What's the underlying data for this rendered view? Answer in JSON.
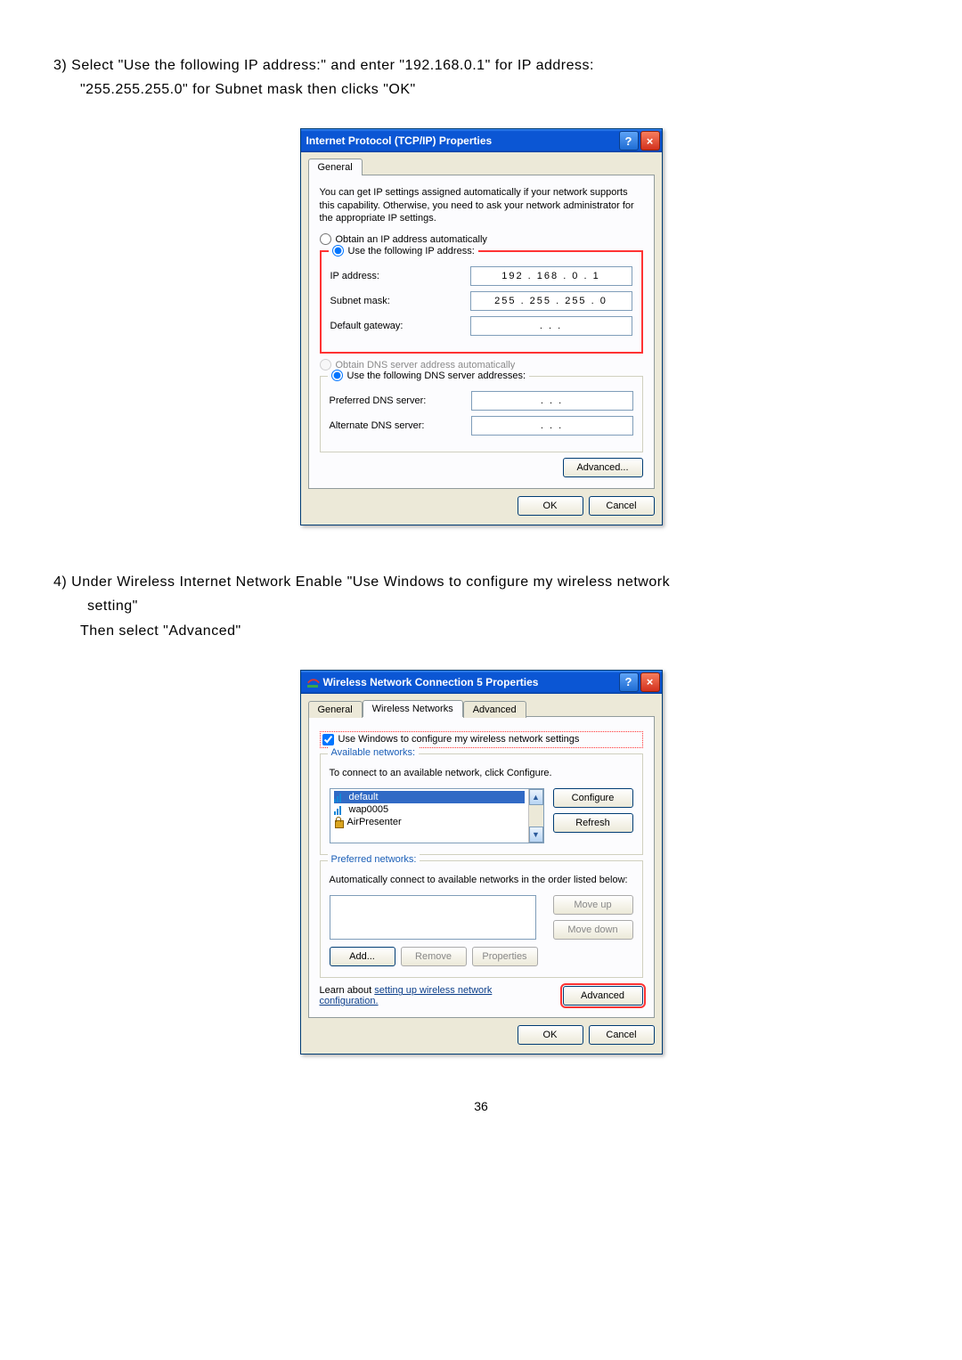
{
  "page_number": "36",
  "step3": {
    "prefix": "3)  Select \"Use the following IP address:\" and enter \"192.168.0.1\" for IP address:",
    "line2": "\"255.255.255.0\" for Subnet mask then clicks \"OK\""
  },
  "tcpip_dialog": {
    "title": "Internet Protocol (TCP/IP) Properties",
    "tab_general": "General",
    "description": "You can get IP settings assigned automatically if your network supports this capability. Otherwise, you need to ask your network administrator for the appropriate IP settings.",
    "radio_obtain_ip": "Obtain an IP address automatically",
    "radio_use_ip": "Use the following IP address:",
    "lbl_ip": "IP address:",
    "val_ip": "192 . 168 .   0  .   1",
    "lbl_subnet": "Subnet mask:",
    "val_subnet": "255 . 255 . 255 .   0",
    "lbl_gateway": "Default gateway:",
    "val_gateway": " .        .        . ",
    "radio_obtain_dns": "Obtain DNS server address automatically",
    "radio_use_dns": "Use the following DNS server addresses:",
    "lbl_pref_dns": "Preferred DNS server:",
    "val_pref_dns": " .        .        . ",
    "lbl_alt_dns": "Alternate DNS server:",
    "val_alt_dns": " .        .        . ",
    "btn_advanced": "Advanced...",
    "btn_ok": "OK",
    "btn_cancel": "Cancel"
  },
  "step4": {
    "line1": "4) Under Wireless Internet Network Enable \"Use Windows to configure my wireless network",
    "line2": " setting\"",
    "line3": "Then select \"Advanced\""
  },
  "wifi_dialog": {
    "title": "Wireless Network Connection 5 Properties",
    "tab_general": "General",
    "tab_wireless": "Wireless Networks",
    "tab_advanced": "Advanced",
    "chk_use_windows": "Use Windows to configure my wireless network settings",
    "grp_available": "Available networks:",
    "available_hint": "To connect to an available network, click Configure.",
    "net1": "default",
    "net2": "wap0005",
    "net3": "AirPresenter",
    "btn_configure": "Configure",
    "btn_refresh": "Refresh",
    "grp_preferred": "Preferred networks:",
    "preferred_hint": "Automatically connect to available networks in the order listed below:",
    "btn_move_up": "Move up",
    "btn_move_down": "Move down",
    "btn_add": "Add...",
    "btn_remove": "Remove",
    "btn_properties": "Properties",
    "learn_text": "Learn about ",
    "learn_link1": "setting up wireless network",
    "learn_link2": "configuration.",
    "btn_advanced": "Advanced",
    "btn_ok": "OK",
    "btn_cancel": "Cancel"
  }
}
